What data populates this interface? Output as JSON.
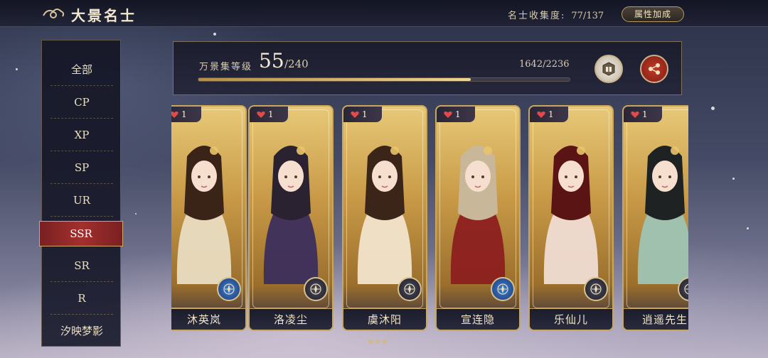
{
  "header": {
    "title": "大景名士",
    "collection_label": "名士收集度:",
    "collection_value": "77/137",
    "attr_button": "属性加成"
  },
  "sidebar": {
    "items": [
      {
        "label": "全部"
      },
      {
        "label": "CP"
      },
      {
        "label": "XP"
      },
      {
        "label": "SP"
      },
      {
        "label": "UR"
      },
      {
        "label": "SSR",
        "active": true
      },
      {
        "label": "SR"
      },
      {
        "label": "R"
      },
      {
        "label": "汐映梦影"
      }
    ]
  },
  "level": {
    "label": "万景集等级",
    "current": "55",
    "max": "/240",
    "exp": "1642/2236",
    "progress_fraction": 0.7343
  },
  "icons": {
    "gift": "gift-icon",
    "share": "share-icon",
    "compass": "compass-icon",
    "heart": "heart-icon"
  },
  "colors": {
    "accent_gold": "#c9a65d",
    "active_red": "#a2302d",
    "heart_red": "#e24a4a"
  },
  "cards": [
    {
      "name": "沐英岚",
      "hearts": "1",
      "badge": "blue"
    },
    {
      "name": "洛凌尘",
      "hearts": "1",
      "badge": "dark"
    },
    {
      "name": "虞沐阳",
      "hearts": "1",
      "badge": "dark"
    },
    {
      "name": "宣连隐",
      "hearts": "1",
      "badge": "blue"
    },
    {
      "name": "乐仙儿",
      "hearts": "1",
      "badge": "dark"
    },
    {
      "name": "逍遥先生",
      "hearts": "1",
      "badge": "dark"
    }
  ]
}
